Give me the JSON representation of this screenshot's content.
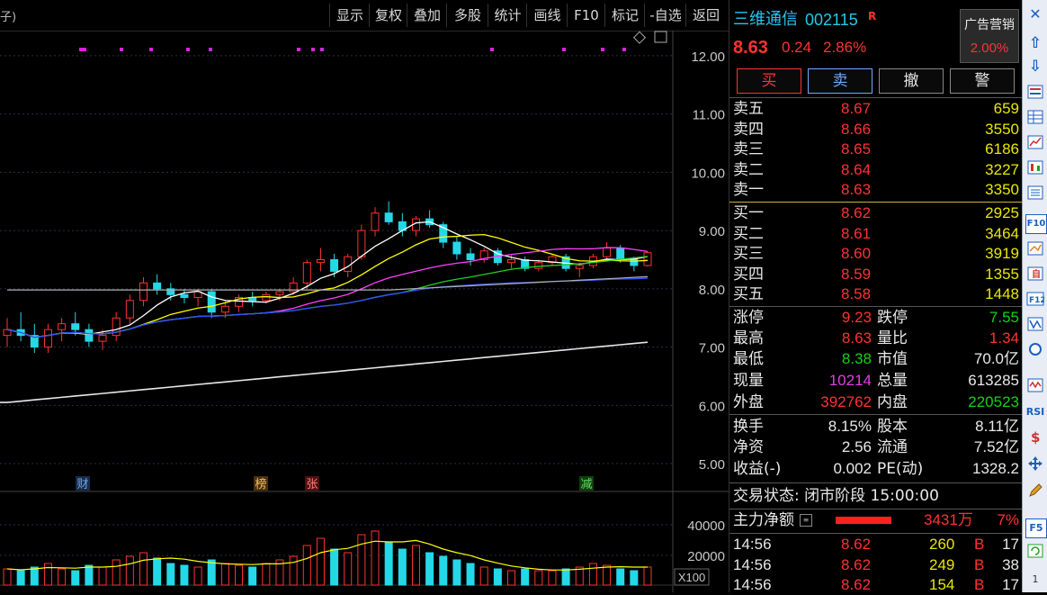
{
  "toolbar": {
    "title_fragment": "子)",
    "buttons": [
      "显示",
      "复权",
      "叠加",
      "多股",
      "统计",
      "画线",
      "F10",
      "标记",
      "-自选",
      "返回"
    ]
  },
  "chart": {
    "price_ticks": [
      "12.00",
      "11.00",
      "10.00",
      "9.00",
      "8.00",
      "7.00",
      "6.00",
      "5.00"
    ],
    "volume_ticks": [
      "40000",
      "20000"
    ],
    "volume_unit": "X100",
    "event_labels": [
      {
        "text": "财",
        "color": "#6ea8e8",
        "bg": "#1a2a48"
      },
      {
        "text": "榜",
        "color": "#f0c060",
        "bg": "#4a3010"
      },
      {
        "text": "张",
        "color": "#ff8080",
        "bg": "#501010"
      },
      {
        "text": "减",
        "color": "#60e060",
        "bg": "#104010"
      }
    ]
  },
  "chart_data": {
    "type": "candlestick",
    "ylim": [
      4.8,
      12.4
    ],
    "candles": [
      [
        7.2,
        7.5,
        7.0,
        7.3
      ],
      [
        7.3,
        7.6,
        7.1,
        7.2
      ],
      [
        7.2,
        7.4,
        6.9,
        7.0
      ],
      [
        7.0,
        7.4,
        6.9,
        7.3
      ],
      [
        7.3,
        7.5,
        7.1,
        7.4
      ],
      [
        7.4,
        7.6,
        7.2,
        7.3
      ],
      [
        7.3,
        7.4,
        7.0,
        7.1
      ],
      [
        7.1,
        7.3,
        6.95,
        7.2
      ],
      [
        7.2,
        7.6,
        7.1,
        7.5
      ],
      [
        7.5,
        7.9,
        7.4,
        7.8
      ],
      [
        7.8,
        8.2,
        7.7,
        8.1
      ],
      [
        8.1,
        8.25,
        7.9,
        8.0
      ],
      [
        8.0,
        8.1,
        7.8,
        7.9
      ],
      [
        7.9,
        8.0,
        7.75,
        7.85
      ],
      [
        7.85,
        8.0,
        7.7,
        7.95
      ],
      [
        7.95,
        8.0,
        7.5,
        7.6
      ],
      [
        7.6,
        7.8,
        7.5,
        7.7
      ],
      [
        7.7,
        7.9,
        7.6,
        7.85
      ],
      [
        7.85,
        7.95,
        7.7,
        7.8
      ],
      [
        7.8,
        7.95,
        7.75,
        7.9
      ],
      [
        7.9,
        8.0,
        7.8,
        7.95
      ],
      [
        7.95,
        8.2,
        7.9,
        8.1
      ],
      [
        8.1,
        8.5,
        8.0,
        8.45
      ],
      [
        8.45,
        8.7,
        8.3,
        8.5
      ],
      [
        8.5,
        8.6,
        8.2,
        8.3
      ],
      [
        8.3,
        8.6,
        8.2,
        8.55
      ],
      [
        8.55,
        9.1,
        8.5,
        9.0
      ],
      [
        9.0,
        9.4,
        8.9,
        9.3
      ],
      [
        9.3,
        9.5,
        9.1,
        9.15
      ],
      [
        9.15,
        9.3,
        8.9,
        9.0
      ],
      [
        9.0,
        9.25,
        8.9,
        9.2
      ],
      [
        9.2,
        9.35,
        9.05,
        9.1
      ],
      [
        9.1,
        9.15,
        8.7,
        8.8
      ],
      [
        8.8,
        8.9,
        8.5,
        8.6
      ],
      [
        8.6,
        8.7,
        8.4,
        8.5
      ],
      [
        8.5,
        8.7,
        8.45,
        8.65
      ],
      [
        8.65,
        8.7,
        8.4,
        8.45
      ],
      [
        8.45,
        8.6,
        8.35,
        8.5
      ],
      [
        8.5,
        8.55,
        8.3,
        8.35
      ],
      [
        8.35,
        8.5,
        8.3,
        8.45
      ],
      [
        8.45,
        8.6,
        8.4,
        8.55
      ],
      [
        8.55,
        8.6,
        8.3,
        8.35
      ],
      [
        8.35,
        8.45,
        8.2,
        8.4
      ],
      [
        8.4,
        8.6,
        8.35,
        8.55
      ],
      [
        8.55,
        8.8,
        8.5,
        8.7
      ],
      [
        8.7,
        8.75,
        8.45,
        8.5
      ],
      [
        8.5,
        8.55,
        8.3,
        8.4
      ],
      [
        8.4,
        8.63,
        8.38,
        8.62
      ]
    ],
    "volumes": [
      9,
      8,
      10,
      12,
      9,
      8,
      11,
      10,
      14,
      16,
      18,
      15,
      12,
      11,
      10,
      14,
      12,
      11,
      10,
      12,
      14,
      16,
      22,
      26,
      20,
      18,
      28,
      30,
      24,
      20,
      22,
      18,
      16,
      14,
      12,
      10,
      9,
      8,
      9,
      8,
      8,
      9,
      10,
      12,
      11,
      9,
      8,
      10
    ]
  },
  "quote": {
    "name": "三维通信",
    "code": "002115",
    "flag": "R",
    "price": "8.63",
    "change": "0.24",
    "change_pct": "2.86%",
    "ad_label": "广告营销",
    "ad_pct": "2.00%",
    "buttons": [
      "买",
      "卖",
      "撤",
      "警"
    ]
  },
  "order_book": {
    "asks": [
      {
        "label": "卖五",
        "price": "8.67",
        "vol": "659"
      },
      {
        "label": "卖四",
        "price": "8.66",
        "vol": "3550"
      },
      {
        "label": "卖三",
        "price": "8.65",
        "vol": "6186"
      },
      {
        "label": "卖二",
        "price": "8.64",
        "vol": "3227"
      },
      {
        "label": "卖一",
        "price": "8.63",
        "vol": "3350"
      }
    ],
    "bids": [
      {
        "label": "买一",
        "price": "8.62",
        "vol": "2925"
      },
      {
        "label": "买二",
        "price": "8.61",
        "vol": "3464"
      },
      {
        "label": "买三",
        "price": "8.60",
        "vol": "3919"
      },
      {
        "label": "买四",
        "price": "8.59",
        "vol": "1355"
      },
      {
        "label": "买五",
        "price": "8.58",
        "vol": "1448"
      }
    ]
  },
  "stats": {
    "limit_up_label": "涨停",
    "limit_up": "9.23",
    "limit_down_label": "跌停",
    "limit_down": "7.55",
    "high_label": "最高",
    "high": "8.63",
    "vol_ratio_label": "量比",
    "vol_ratio": "1.34",
    "low_label": "最低",
    "low": "8.38",
    "mkt_cap_label": "市值",
    "mkt_cap": "70.0亿",
    "cur_vol_label": "现量",
    "cur_vol": "10214",
    "total_vol_label": "总量",
    "total_vol": "613285",
    "outer_label": "外盘",
    "outer": "392762",
    "inner_label": "内盘",
    "inner": "220523",
    "turnover_label": "换手",
    "turnover": "8.15%",
    "shares_label": "股本",
    "shares": "8.11亿",
    "nav_label": "净资",
    "nav": "2.56",
    "float_label": "流通",
    "float": "7.52亿",
    "eps_label": "收益(-)",
    "eps": "0.002",
    "pe_label": "PE(动)",
    "pe": "1328.2"
  },
  "status": {
    "text": "交易状态: 闭市阶段 15:00:00"
  },
  "main_flow": {
    "label": "主力净额",
    "value": "3431万",
    "pct": "7%"
  },
  "ticks": [
    {
      "time": "14:56",
      "price": "8.62",
      "vol": "260",
      "side": "B",
      "n": "17"
    },
    {
      "time": "14:56",
      "price": "8.62",
      "vol": "249",
      "side": "B",
      "n": "38"
    },
    {
      "time": "14:56",
      "price": "8.62",
      "vol": "154",
      "side": "B",
      "n": "17"
    }
  ],
  "tools": [
    "⇧",
    "⇩",
    "F10",
    "RSI",
    "F5",
    "1"
  ]
}
